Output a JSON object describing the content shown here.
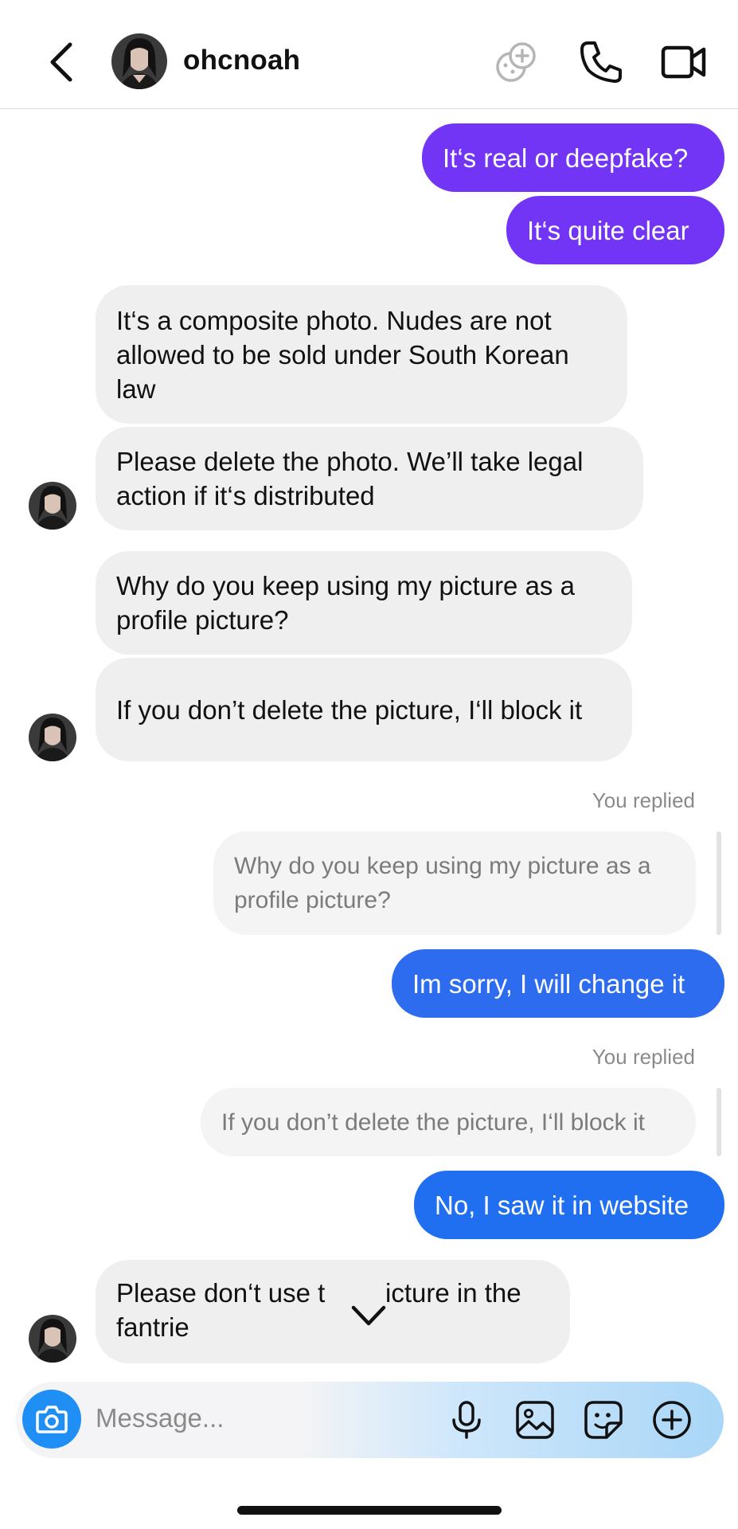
{
  "header": {
    "username": "ohcnoah",
    "icons": [
      "back-chevron-icon",
      "avatar",
      "effects-icon",
      "phone-icon",
      "video-camera-icon"
    ]
  },
  "messages": {
    "m1": "It‘s real or deepfake?",
    "m2": "It‘s quite clear",
    "m3": "It‘s a composite photo. Nudes are not allowed to be sold under South Korean law",
    "m4": "Please delete the photo. We’ll take legal action if it‘s distributed",
    "m5": "Why do you keep using my picture as a profile picture?",
    "m6": "If you don’t delete the picture, I‘ll block it",
    "replied1": "You replied",
    "quote1": "Why do you keep using my picture as a profile picture?",
    "m7": "Im sorry, I will change it",
    "replied2": "You replied",
    "quote2": "If you don’t delete the picture, I‘ll block it",
    "m8": "No, I saw it in website",
    "m9a": "Please don‘t use t",
    "m9b": "icture in the",
    "m9c": "fantrie"
  },
  "composer": {
    "placeholder": "Message...",
    "icons": [
      "camera-icon",
      "microphone-icon",
      "gallery-icon",
      "sticker-icon",
      "plus-icon"
    ]
  },
  "colors": {
    "purple_bubble": "#7234f5",
    "blue_bubble": "#2d6bef",
    "received_bubble": "#efefef",
    "camera_button": "#1f8ff5"
  }
}
